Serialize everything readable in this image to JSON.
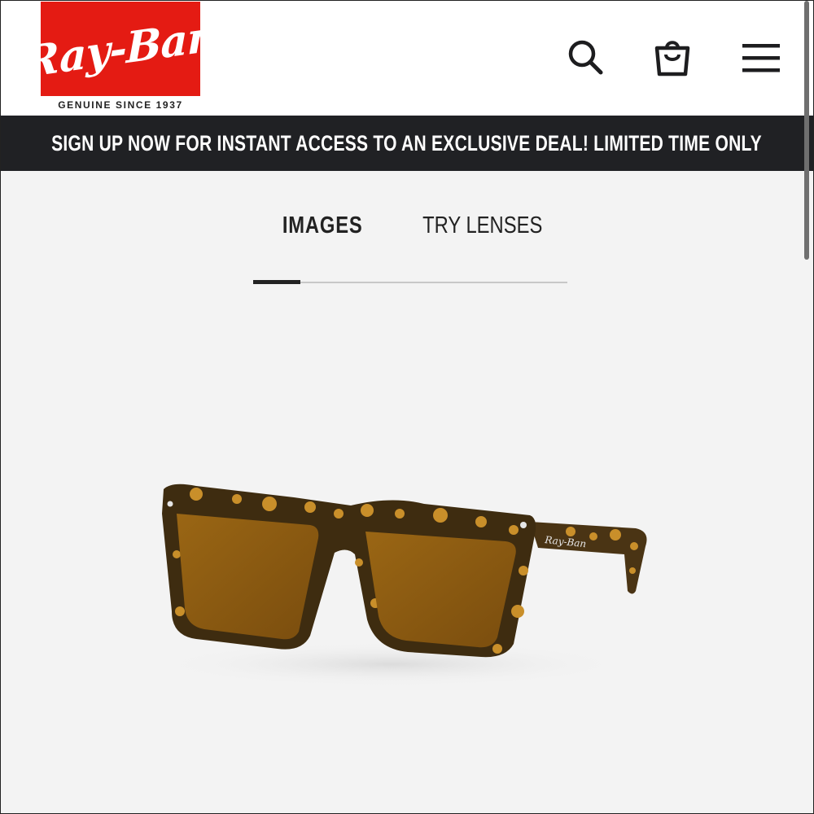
{
  "brand": {
    "logo_text": "Ray-Ban",
    "tagline": "GENUINE SINCE 1937",
    "logo_color": "#e41b13"
  },
  "header": {
    "icons": [
      "search-icon",
      "shopping-bag-icon",
      "menu-icon"
    ]
  },
  "promo": {
    "text": "SIGN UP NOW FOR INSTANT ACCESS TO AN EXCLUSIVE DEAL! LIMITED TIME ONLY",
    "background": "#202124"
  },
  "tabs": [
    {
      "label": "IMAGES",
      "active": true
    },
    {
      "label": "TRY LENSES",
      "active": false
    }
  ],
  "gallery": {
    "progress": 0.15
  },
  "product_image": {
    "frame_color": "#3a2a12",
    "lens_color": "#8a5a12",
    "temple_text": "Ray-Ban"
  }
}
